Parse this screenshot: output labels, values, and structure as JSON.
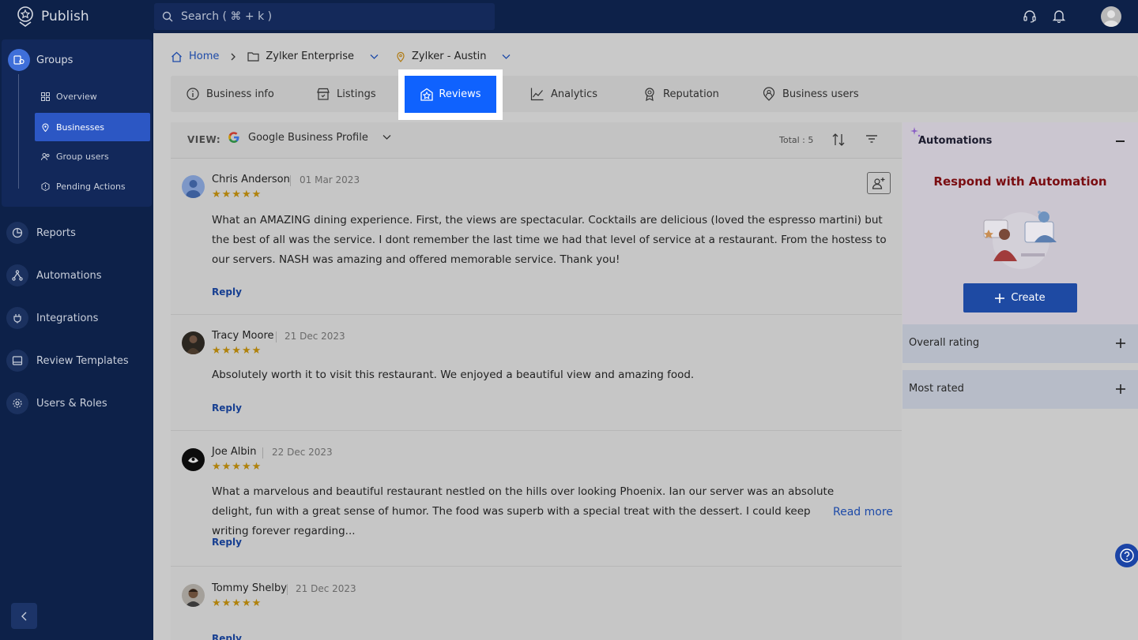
{
  "app": {
    "title": "Publish"
  },
  "search": {
    "placeholder": "Search ( ⌘ + k )"
  },
  "topbar_icons": [
    "headset-icon",
    "bell-icon",
    "avatar"
  ],
  "sidebar": {
    "group": {
      "label": "Groups",
      "icon": "groups-icon"
    },
    "sub_items": [
      {
        "label": "Overview",
        "icon": "grid-icon",
        "active": false
      },
      {
        "label": "Businesses",
        "icon": "location-pin-icon",
        "active": true
      },
      {
        "label": "Group users",
        "icon": "users-icon",
        "active": false
      },
      {
        "label": "Pending Actions",
        "icon": "hexagon-alert-icon",
        "active": false
      }
    ],
    "items": [
      {
        "label": "Reports",
        "icon": "pie-chart-icon"
      },
      {
        "label": "Automations",
        "icon": "flow-icon"
      },
      {
        "label": "Integrations",
        "icon": "plug-icon"
      },
      {
        "label": "Review Templates",
        "icon": "template-icon"
      },
      {
        "label": "Users & Roles",
        "icon": "gear-icon"
      }
    ]
  },
  "breadcrumb": {
    "home": "Home",
    "enterprise": "Zylker Enterprise",
    "location": "Zylker - Austin"
  },
  "tabs": [
    {
      "label": "Business info",
      "icon": "info-icon"
    },
    {
      "label": "Listings",
      "icon": "store-icon"
    },
    {
      "label": "Reviews",
      "icon": "review-star-icon",
      "active": true
    },
    {
      "label": "Analytics",
      "icon": "line-chart-icon"
    },
    {
      "label": "Reputation",
      "icon": "badge-icon"
    },
    {
      "label": "Business users",
      "icon": "user-pin-icon"
    }
  ],
  "view": {
    "label": "VIEW:",
    "source": "Google Business Profile",
    "total": "Total : 5"
  },
  "reviews": [
    {
      "name": "Chris Anderson",
      "date": "01 Mar 2023",
      "rating": 5,
      "stars": "★★★★★",
      "text": "What an AMAZING dining experience. First, the views are spectacular. Cocktails are delicious (loved the espresso martini) but the best of all was the service. I dont remember the last time we had that level of service at a restaurant. From the hostess to our servers. NASH was amazing and offered memorable service. Thank you!",
      "reply": "Reply"
    },
    {
      "name": "Tracy Moore",
      "date": "21 Dec 2023",
      "rating": 5,
      "stars": "★★★★★",
      "text": "Absolutely worth it to visit this restaurant. We enjoyed a beautiful view and amazing food.",
      "reply": "Reply"
    },
    {
      "name": "Joe Albin",
      "date": "22 Dec 2023",
      "rating": 5,
      "stars": "★★★★★",
      "text": "What a marvelous and beautiful restaurant nestled on the hills over looking Phoenix. Ian our server was an absolute delight, fun with a great sense of humor. The food was superb with a special treat with the dessert. I could keep writing forever regarding...",
      "read_more": "Read more",
      "reply": "Reply"
    },
    {
      "name": "Tommy Shelby",
      "date": "21 Dec 2023",
      "rating": 5,
      "stars": "★★★★★",
      "reply": "Reply"
    }
  ],
  "automations": {
    "title": "Automations",
    "subtitle": "Respond with Automation",
    "create_label": "Create"
  },
  "accordions": [
    {
      "label": "Overall rating"
    },
    {
      "label": "Most rated"
    }
  ],
  "colors": {
    "sidebar": "#0d2149",
    "accent": "#0f62fe",
    "star": "#b0820c",
    "automation_subtitle": "#7a0d11"
  }
}
